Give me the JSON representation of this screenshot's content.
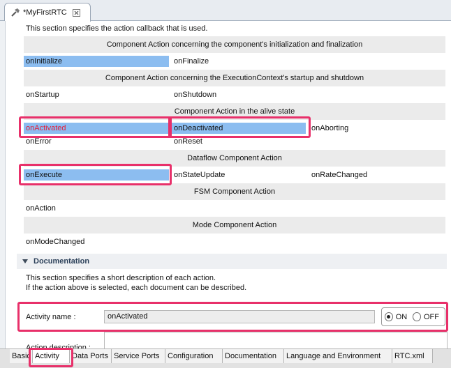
{
  "editor": {
    "tab_title": "*MyFirstRTC",
    "intro_text": "This section specifies the action callback that is used."
  },
  "sections": [
    {
      "header": "Component Action concerning the component's initialization and finalization"
    },
    {
      "header": "Component Action concerning the ExecutionContext's startup and shutdown"
    },
    {
      "header": "Component Action in the alive state"
    },
    {
      "header": "Dataflow Component Action"
    },
    {
      "header": "FSM Component Action"
    },
    {
      "header": "Mode Component Action"
    }
  ],
  "actions": {
    "onInitialize": "onInitialize",
    "onFinalize": "onFinalize",
    "onStartup": "onStartup",
    "onShutdown": "onShutdown",
    "onActivated": "onActivated",
    "onDeactivated": "onDeactivated",
    "onAborting": "onAborting",
    "onError": "onError",
    "onReset": "onReset",
    "onExecute": "onExecute",
    "onStateUpdate": "onStateUpdate",
    "onRateChanged": "onRateChanged",
    "onAction": "onAction",
    "onModeChanged": "onModeChanged"
  },
  "documentation": {
    "header": "Documentation",
    "line1": "This section specifies a short description of each action.",
    "line2": "If the action above is selected, each document can be described.",
    "activity_name_label": "Activity name :",
    "activity_name_value": "onActivated",
    "radio_on": "ON",
    "radio_off": "OFF",
    "selected": "ON",
    "action_desc_label": "Action description :"
  },
  "bottom_tabs": [
    "Basic",
    "Activity",
    "Data Ports",
    "Service Ports",
    "Configuration",
    "Documentation",
    "Language and Environment",
    "RTC.xml"
  ],
  "active_bottom_tab": "Activity",
  "colors": {
    "selection": "#8cbdf0",
    "highlight": "#e8306a",
    "active_text": "#e0213f"
  }
}
